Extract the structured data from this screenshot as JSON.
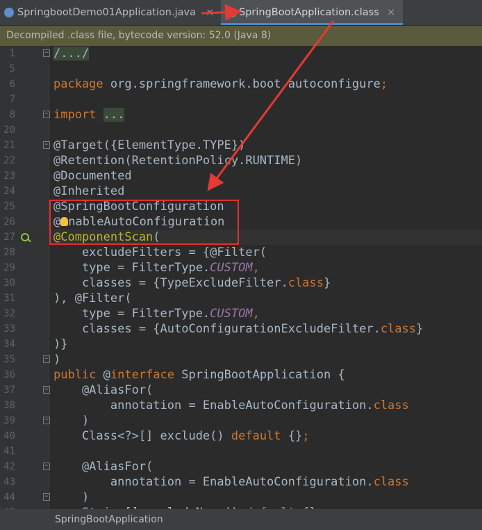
{
  "tabs": [
    {
      "label": "SpringbootDemo01Application.java",
      "close": "×",
      "icon": "java-class-icon"
    },
    {
      "label": "SpringBootApplication.class",
      "close": "×",
      "icon": "class-file-icon",
      "active": true
    }
  ],
  "notice": "Decompiled .class file, bytecode version: 52.0 (Java 8)",
  "lines": [
    {
      "n": "1",
      "fold": true,
      "code": [
        {
          "t": "/.../",
          "c": "fcode"
        }
      ]
    },
    {
      "n": "5",
      "code": []
    },
    {
      "n": "6",
      "code": [
        {
          "t": "package",
          "c": "kw"
        },
        {
          "t": " org.springframework.boot.autoconfigure"
        },
        {
          "t": ";",
          "c": "kw"
        }
      ]
    },
    {
      "n": "7",
      "code": []
    },
    {
      "n": "8",
      "fold": true,
      "code": [
        {
          "t": "import",
          "c": "kw"
        },
        {
          "t": " "
        },
        {
          "t": "...",
          "c": "fcode"
        }
      ]
    },
    {
      "n": "20",
      "code": []
    },
    {
      "n": "21",
      "fold": true,
      "code": [
        {
          "t": "@Target({ElementType.TYPE})"
        }
      ]
    },
    {
      "n": "22",
      "code": [
        {
          "t": "@Retention(RetentionPolicy.RUNTIME)"
        }
      ]
    },
    {
      "n": "23",
      "code": [
        {
          "t": "@Documented"
        }
      ]
    },
    {
      "n": "24",
      "code": [
        {
          "t": "@Inherited"
        }
      ]
    },
    {
      "n": "25",
      "code": [
        {
          "t": "@SpringBootConfiguration"
        }
      ]
    },
    {
      "n": "26",
      "code": [
        {
          "t": "@"
        },
        {
          "bulb": true
        },
        {
          "t": "nableAutoConfiguration"
        }
      ]
    },
    {
      "n": "27",
      "current": true,
      "gutterIcon": "search-usages-icon",
      "code": [
        {
          "t": "@ComponentScan",
          "c": "an"
        },
        {
          "t": "("
        }
      ]
    },
    {
      "n": "28",
      "code": [
        {
          "t": "    excludeFilters = {@Filter("
        }
      ]
    },
    {
      "n": "29",
      "code": [
        {
          "t": "    type = FilterType."
        },
        {
          "t": "CUSTOM",
          "c": "fd"
        },
        {
          "t": ",",
          "c": "kw"
        }
      ]
    },
    {
      "n": "30",
      "code": [
        {
          "t": "    classes = {TypeExcludeFilter."
        },
        {
          "t": "class",
          "c": "kw"
        },
        {
          "t": "}"
        }
      ]
    },
    {
      "n": "31",
      "code": [
        {
          "t": "), @Filter("
        }
      ]
    },
    {
      "n": "32",
      "code": [
        {
          "t": "    type = FilterType."
        },
        {
          "t": "CUSTOM",
          "c": "fd"
        },
        {
          "t": ",",
          "c": "kw"
        }
      ]
    },
    {
      "n": "33",
      "code": [
        {
          "t": "    classes = {AutoConfigurationExcludeFilter."
        },
        {
          "t": "class",
          "c": "kw"
        },
        {
          "t": "}"
        }
      ]
    },
    {
      "n": "34",
      "code": [
        {
          "t": ")}"
        }
      ]
    },
    {
      "n": "35",
      "fold": true,
      "code": [
        {
          "t": ")"
        }
      ]
    },
    {
      "n": "36",
      "code": [
        {
          "t": "public",
          "c": "kw"
        },
        {
          "t": " @"
        },
        {
          "t": "interface",
          "c": "kw"
        },
        {
          "t": " SpringBootApplication {"
        }
      ]
    },
    {
      "n": "37",
      "fold": true,
      "code": [
        {
          "t": "    @AliasFor("
        }
      ]
    },
    {
      "n": "38",
      "code": [
        {
          "t": "        annotation = EnableAutoConfiguration."
        },
        {
          "t": "class",
          "c": "kw"
        }
      ]
    },
    {
      "n": "39",
      "fold": true,
      "code": [
        {
          "t": "    )"
        }
      ]
    },
    {
      "n": "40",
      "code": [
        {
          "t": "    Class<?>[] exclude() "
        },
        {
          "t": "default",
          "c": "kw"
        },
        {
          "t": " {}"
        },
        {
          "t": ";",
          "c": "kw"
        }
      ]
    },
    {
      "n": "41",
      "code": []
    },
    {
      "n": "42",
      "fold": true,
      "code": [
        {
          "t": "    @AliasFor("
        }
      ]
    },
    {
      "n": "43",
      "code": [
        {
          "t": "        annotation = EnableAutoConfiguration."
        },
        {
          "t": "class",
          "c": "kw"
        }
      ]
    },
    {
      "n": "44",
      "fold": true,
      "code": [
        {
          "t": "    )"
        }
      ]
    },
    {
      "n": "45",
      "code": [
        {
          "t": "    String[] excludeName() "
        },
        {
          "t": "default",
          "c": "kw"
        },
        {
          "t": " {}"
        },
        {
          "t": ";",
          "c": "kw"
        }
      ]
    }
  ],
  "statusbar": "SpringBootApplication",
  "colors": {
    "annotation_box": "#e03030",
    "arrow": "#e53935"
  }
}
